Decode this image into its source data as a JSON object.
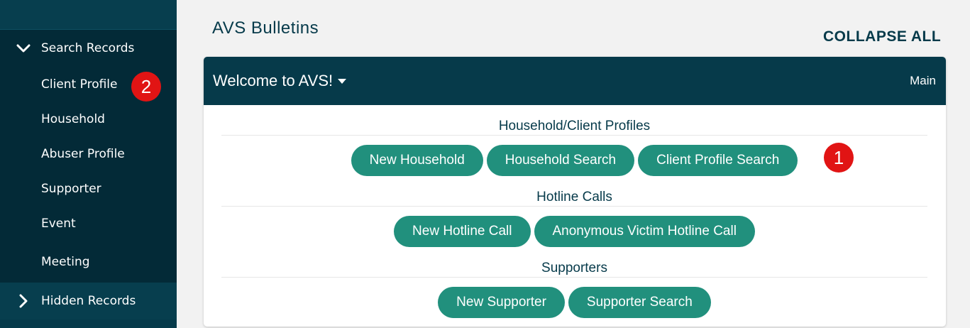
{
  "sidebar": {
    "search_records": {
      "label": "Search Records",
      "items": [
        {
          "label": "Client Profile"
        },
        {
          "label": "Household"
        },
        {
          "label": "Abuser Profile"
        },
        {
          "label": "Supporter"
        },
        {
          "label": "Event"
        },
        {
          "label": "Meeting"
        }
      ]
    },
    "hidden_records": {
      "label": "Hidden Records"
    }
  },
  "header": {
    "title": "AVS Bulletins",
    "collapse_all": "COLLAPSE ALL"
  },
  "panel": {
    "title": "Welcome to AVS!",
    "right_label": "Main",
    "groups": [
      {
        "label": "Household/Client Profiles",
        "buttons": [
          "New Household",
          "Household Search",
          "Client Profile Search"
        ]
      },
      {
        "label": "Hotline Calls",
        "buttons": [
          "New Hotline Call",
          "Anonymous Victim Hotline Call"
        ]
      },
      {
        "label": "Supporters",
        "buttons": [
          "New Supporter",
          "Supporter Search"
        ]
      }
    ]
  },
  "annotations": {
    "badge_1": "1",
    "badge_2": "2"
  },
  "colors": {
    "sidebar_bg": "#063a4a",
    "sidebar_section_bg": "#032a37",
    "accent_button": "#21907d",
    "badge_red": "#e11414"
  },
  "icons": {
    "expanded": "chevron-down-icon",
    "collapsed": "chevron-right-icon",
    "dropdown": "caret-down-icon"
  }
}
